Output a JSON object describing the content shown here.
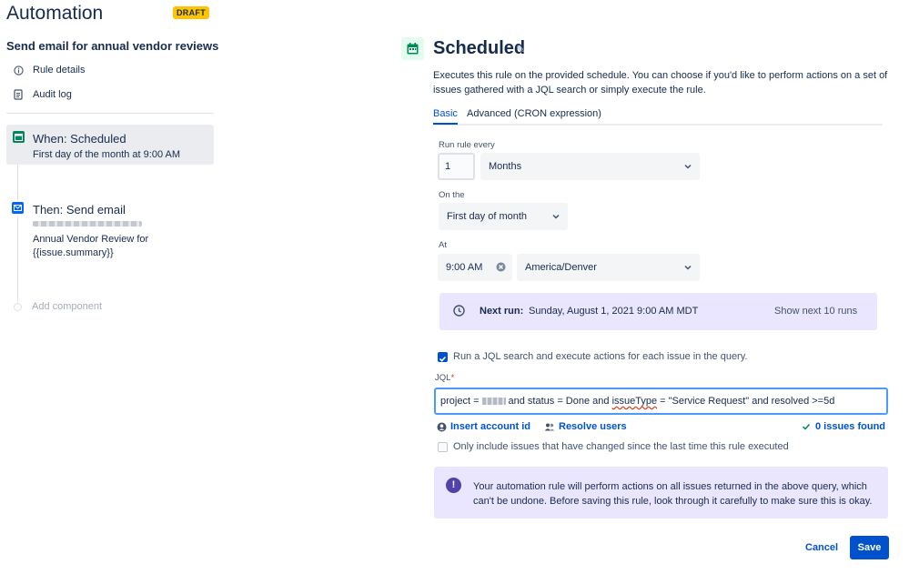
{
  "sidebar": {
    "app_title": "Automation",
    "badge": "DRAFT",
    "rule_name": "Send email for annual vendor reviews",
    "links": [
      {
        "label": "Rule details",
        "icon": "info-icon"
      },
      {
        "label": "Audit log",
        "icon": "document-icon"
      }
    ],
    "components": [
      {
        "title": "When: Scheduled",
        "subtitle": "First day of the month at 9:00 AM",
        "icon": "calendar-icon",
        "color": "#00875a"
      },
      {
        "title": "Then: Send email",
        "subtitle_line1": "Annual Vendor Review for",
        "subtitle_line2": "{{issue.summary}}",
        "icon": "mail-icon",
        "color": "#0065ff"
      }
    ],
    "add_component": "Add component"
  },
  "main": {
    "title": "Scheduled",
    "description": "Executes this rule on the provided schedule. You can choose if you'd like to perform actions on a set of issues gathered with a JQL search or simply execute the rule.",
    "tabs": [
      {
        "label": "Basic",
        "active": true
      },
      {
        "label": "Advanced (CRON expression)",
        "active": false
      }
    ],
    "form": {
      "run_every_label": "Run rule every",
      "run_every_value": "1",
      "run_every_unit": "Months",
      "on_the_label": "On the",
      "on_the_value": "First day of month",
      "at_label": "At",
      "time_value": "9:00 AM",
      "timezone_value": "America/Denver"
    },
    "next_run": {
      "label": "Next run:",
      "value": "Sunday, August 1, 2021 9:00 AM MDT",
      "show_more": "Show next 10 runs"
    },
    "jql_checkbox": {
      "label": "Run a JQL search and execute actions for each issue in the query.",
      "checked": true
    },
    "jql": {
      "label": "JQL",
      "required_mark": "*",
      "prefix": "project =",
      "middle": "and status = Done and",
      "misspelled": "issueType",
      "suffix": "= \"Service Request\" and resolved >=5d"
    },
    "jql_actions": {
      "insert_account": "Insert account id",
      "resolve_users": "Resolve users",
      "issues_found": "0 issues found"
    },
    "changed_checkbox": {
      "label": "Only include issues that have changed since the last time this rule executed",
      "checked": false
    },
    "warning": {
      "icon": "!",
      "text": "Your automation rule will perform actions on all issues returned in the above query, which can't be undone. Before saving this rule, look through it carefully to make sure this is okay."
    },
    "buttons": {
      "cancel": "Cancel",
      "save": "Save"
    }
  },
  "colors": {
    "accent": "#0052cc",
    "badge": "#ffc400",
    "info_bg": "#eae6ff",
    "trigger_green": "#00875a"
  }
}
